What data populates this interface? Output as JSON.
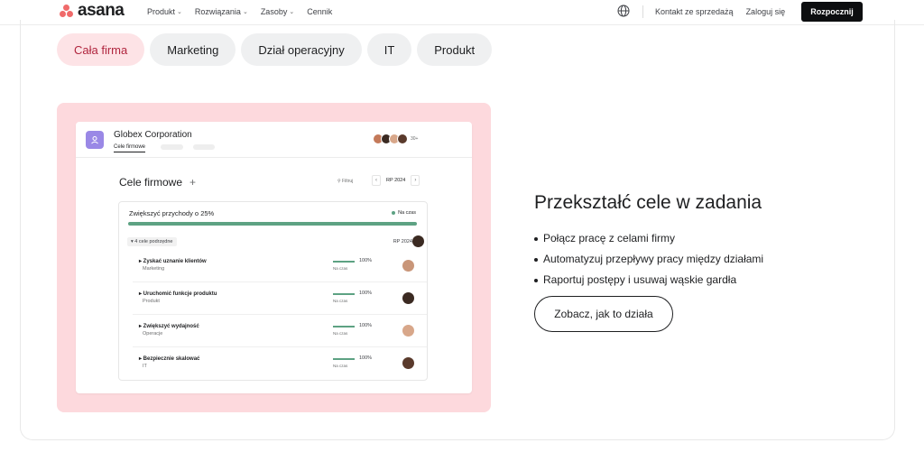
{
  "nav": {
    "logo_text": "asana",
    "menu": [
      {
        "label": "Produkt",
        "chevron": "⌄"
      },
      {
        "label": "Rozwiązania",
        "chevron": "⌄"
      },
      {
        "label": "Zasoby",
        "chevron": "⌄"
      },
      {
        "label": "Cennik",
        "chevron": ""
      }
    ],
    "contact_sales": "Kontakt ze sprzedażą",
    "login": "Zaloguj się",
    "cta": "Rozpocznij",
    "globe_icon": "globe-icon"
  },
  "tabs": [
    {
      "label": "Cała firma",
      "active": true
    },
    {
      "label": "Marketing",
      "active": false
    },
    {
      "label": "Dział operacyjny",
      "active": false
    },
    {
      "label": "IT",
      "active": false
    },
    {
      "label": "Produkt",
      "active": false
    }
  ],
  "mock": {
    "workspace_name": "Globex Corporation",
    "workspace_tab": "Cele firmowe",
    "avatars_more": "30+",
    "goals_title": "Cele firmowe",
    "add_symbol": "+",
    "filter_label": "⚲ Filtruj",
    "period_label": "RP 2024",
    "prev_arrow": "‹",
    "next_arrow": "›",
    "main_goal": "Zwiększyć przychody o 25%",
    "main_status": "Na czas",
    "main_progress": 1.0,
    "subgoals_label": "▾ 4 cele podrzędne",
    "subgoals_period": "RP 2024",
    "rows": [
      {
        "name": "▸ Zyskać uznanie klientów",
        "category": "Marketing",
        "percent": "100%",
        "status": "Na czas",
        "avatar_color": "#c99679"
      },
      {
        "name": "▸ Uruchomić funkcje produktu",
        "category": "Produkt",
        "percent": "100%",
        "status": "Na czas",
        "avatar_color": "#3b2a22"
      },
      {
        "name": "▸ Zwiększyć wydajność",
        "category": "Operacje",
        "percent": "100%",
        "status": "Na czas",
        "avatar_color": "#d8a78a"
      },
      {
        "name": "▸ Bezpiecznie skalować",
        "category": "IT",
        "percent": "100%",
        "status": "Na czas",
        "avatar_color": "#5a3a2c"
      }
    ]
  },
  "feature": {
    "heading": "Przekształć cele w zadania",
    "bullets": [
      "Połącz pracę z celami firmy",
      "Automatyzuj przepływy pracy między działami",
      "Raportuj postępy i usuwaj wąskie gardła"
    ],
    "button": "Zobacz, jak to działa"
  },
  "colors": {
    "brand_coral": "#f06a6a",
    "active_tab_bg": "#fde3e6",
    "showcase_bg": "#fdd9dd",
    "progress_green": "#5da283"
  }
}
